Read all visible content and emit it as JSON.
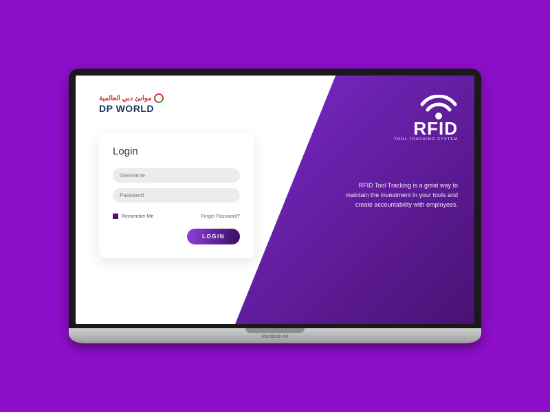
{
  "brand": {
    "arabic": "موانئ دبي العالمية",
    "main": "DP WORLD"
  },
  "login": {
    "title": "Login",
    "username_placeholder": "Username",
    "password_placeholder": "Password",
    "remember_label": "Remember Me",
    "forgot_label": "Forget Password?",
    "button_label": "LOGIN"
  },
  "rfid": {
    "title": "RFID",
    "subtitle": "TOOL TRACKING SYSTEM",
    "tagline": "RFID Tool Tracking is a great way to maintain the investment in your tools and create accountability with employees."
  },
  "device": {
    "label": "MacBook Air"
  }
}
